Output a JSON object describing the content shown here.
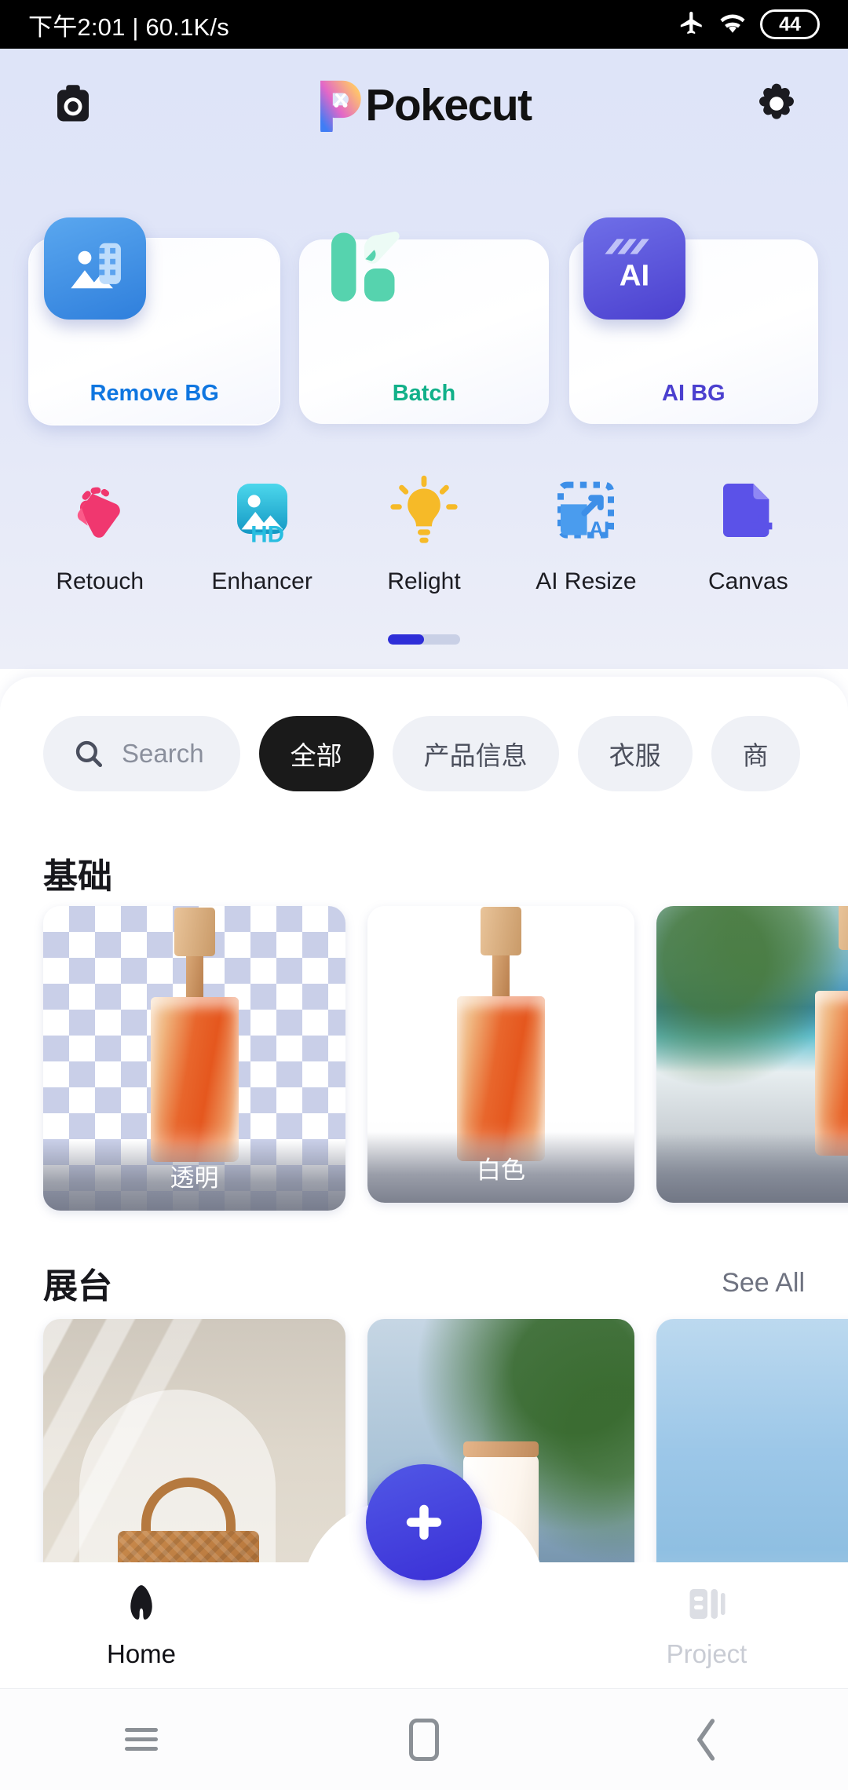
{
  "statusbar": {
    "time_network": "下午2:01 | 60.1K/s",
    "airplane_icon": "airplane-icon",
    "wifi_icon": "wifi-icon",
    "battery_level": "44"
  },
  "appbar": {
    "camera_icon": "camera-icon",
    "app_name": "Pokecut",
    "settings_icon": "gear-icon"
  },
  "feature_cards": [
    {
      "label": "Remove BG",
      "color": "#0f76e0",
      "icon": "remove-background-icon",
      "selected": true
    },
    {
      "label": "Batch",
      "color": "#12b089",
      "icon": "batch-icon",
      "selected": false
    },
    {
      "label": "AI BG",
      "color": "#4b40cf",
      "icon": "ai-background-icon",
      "selected": false
    }
  ],
  "tools": [
    {
      "label": "Retouch",
      "icon": "retouch-icon",
      "color": "#f0376f"
    },
    {
      "label": "Enhancer",
      "icon": "enhancer-hd-icon",
      "color": "#28c0e0"
    },
    {
      "label": "Relight",
      "icon": "lightbulb-icon",
      "color": "#f6ba28"
    },
    {
      "label": "AI Resize",
      "icon": "ai-resize-icon",
      "color": "#3d8fe8"
    },
    {
      "label": "Canvas",
      "icon": "canvas-icon",
      "color": "#5b52e8"
    }
  ],
  "pager": {
    "indicator": "scroll-indicator",
    "active_fraction": 0.5
  },
  "search": {
    "icon": "search-icon",
    "placeholder": "Search"
  },
  "chips": [
    {
      "label": "全部",
      "active": true
    },
    {
      "label": "产品信息",
      "active": false
    },
    {
      "label": "衣服",
      "active": false
    },
    {
      "label": "商",
      "active": false
    }
  ],
  "sections": [
    {
      "title": "基础",
      "see_all": "",
      "items": [
        {
          "caption": "透明",
          "style": "checker"
        },
        {
          "caption": "白色",
          "style": "white"
        },
        {
          "caption": "",
          "style": "beach"
        }
      ]
    },
    {
      "title": "展台",
      "see_all": "See All",
      "items": [
        {
          "caption": "",
          "style": "arch"
        },
        {
          "caption": "",
          "style": "water"
        },
        {
          "caption": "",
          "style": "sky"
        }
      ]
    }
  ],
  "bottom_nav": {
    "home": {
      "label": "Home",
      "icon": "home-icon",
      "active": true
    },
    "add": {
      "label": "",
      "icon": "plus-icon",
      "color": "#3a2fd6"
    },
    "project": {
      "label": "Project",
      "icon": "project-icon",
      "active": false
    }
  },
  "android_nav": {
    "recents_icon": "recents-icon",
    "home_icon": "home-square-icon",
    "back_icon": "back-chevron-icon"
  }
}
